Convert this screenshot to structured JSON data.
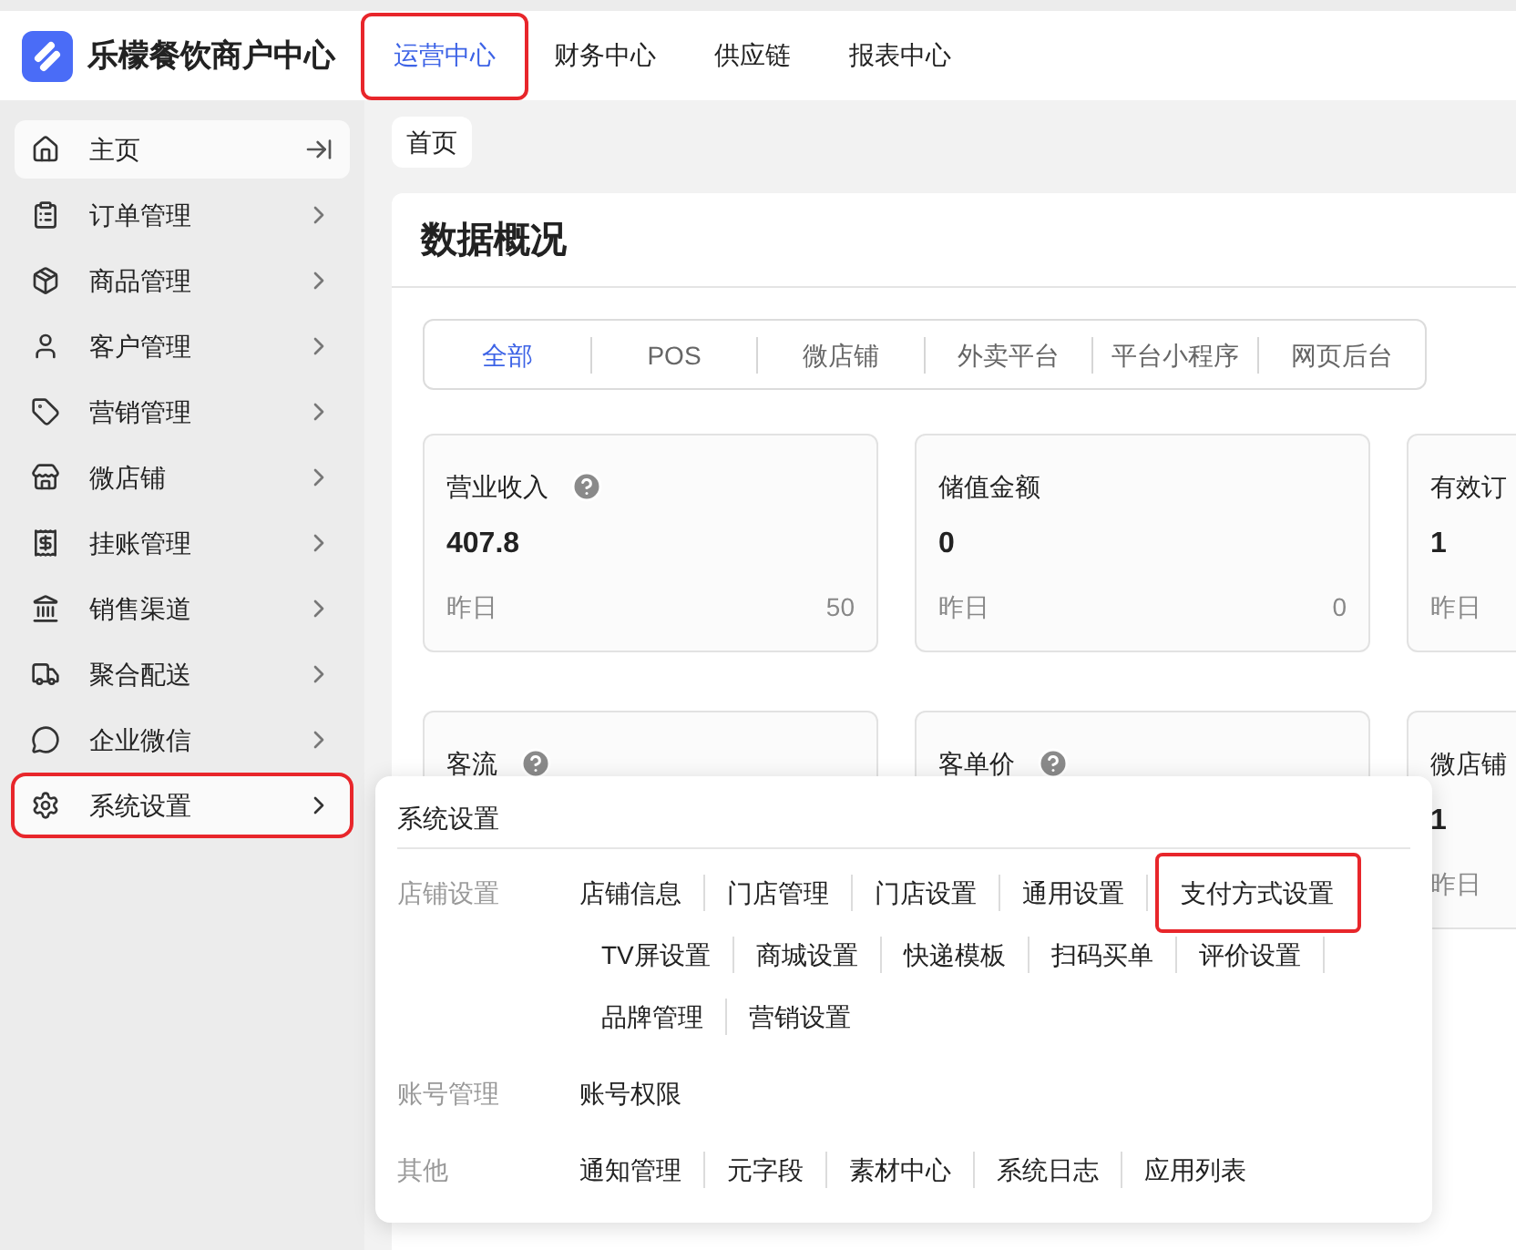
{
  "brand": {
    "title": "乐檬餐饮商户中心"
  },
  "top_nav": [
    {
      "label": "运营中心",
      "selected": true,
      "highlighted": true
    },
    {
      "label": "财务中心",
      "selected": false,
      "highlighted": false
    },
    {
      "label": "供应链",
      "selected": false,
      "highlighted": false
    },
    {
      "label": "报表中心",
      "selected": false,
      "highlighted": false
    }
  ],
  "sidebar": {
    "items": [
      {
        "kind": "home",
        "label": "主页",
        "selected": true,
        "expanded": false,
        "highlighted": false
      },
      {
        "kind": "order",
        "label": "订单管理",
        "selected": false,
        "expanded": false,
        "highlighted": false
      },
      {
        "kind": "goods",
        "label": "商品管理",
        "selected": false,
        "expanded": false,
        "highlighted": false
      },
      {
        "kind": "customer",
        "label": "客户管理",
        "selected": false,
        "expanded": false,
        "highlighted": false
      },
      {
        "kind": "marketing",
        "label": "营销管理",
        "selected": false,
        "expanded": false,
        "highlighted": false
      },
      {
        "kind": "shop",
        "label": "微店铺",
        "selected": false,
        "expanded": false,
        "highlighted": false
      },
      {
        "kind": "credit",
        "label": "挂账管理",
        "selected": false,
        "expanded": false,
        "highlighted": false
      },
      {
        "kind": "channel",
        "label": "销售渠道",
        "selected": false,
        "expanded": false,
        "highlighted": false
      },
      {
        "kind": "delivery",
        "label": "聚合配送",
        "selected": false,
        "expanded": false,
        "highlighted": false
      },
      {
        "kind": "wechat",
        "label": "企业微信",
        "selected": false,
        "expanded": false,
        "highlighted": false
      },
      {
        "kind": "settings",
        "label": "系统设置",
        "selected": true,
        "expanded": true,
        "highlighted": true
      }
    ]
  },
  "page_tabs": [
    {
      "label": "首页",
      "selected": true
    }
  ],
  "overview": {
    "title": "数据概况",
    "filters": [
      {
        "label": "全部",
        "selected": true
      },
      {
        "label": "POS",
        "selected": false
      },
      {
        "label": "微店铺",
        "selected": false
      },
      {
        "label": "外卖平台",
        "selected": false
      },
      {
        "label": "平台小程序",
        "selected": false
      },
      {
        "label": "网页后台",
        "selected": false
      }
    ],
    "cards": [
      {
        "label": "营业收入",
        "help": true,
        "value": "407.8",
        "compare_label": "昨日",
        "compare_value": "50"
      },
      {
        "label": "储值金额",
        "value": "0",
        "compare_label": "昨日",
        "compare_value": "0"
      },
      {
        "label": "有效订",
        "value": "1",
        "compare_label": "昨日"
      },
      {
        "label": "客流",
        "help": true
      },
      {
        "label": "客单价",
        "help": true
      },
      {
        "label": "微店铺",
        "value": "1",
        "compare_label": "昨日"
      }
    ]
  },
  "settings_menu": {
    "title": "系统设置",
    "groups": [
      {
        "label": "店铺设置",
        "items": [
          {
            "label": "店铺信息",
            "highlighted": false
          },
          {
            "label": "门店管理",
            "highlighted": false
          },
          {
            "label": "门店设置",
            "highlighted": false
          },
          {
            "label": "通用设置",
            "highlighted": false
          },
          {
            "label": "支付方式设置",
            "highlighted": true
          },
          {
            "label": "TV屏设置",
            "highlighted": false
          },
          {
            "label": "商城设置",
            "highlighted": false
          },
          {
            "label": "快递模板",
            "highlighted": false
          },
          {
            "label": "扫码买单",
            "highlighted": false
          },
          {
            "label": "评价设置",
            "highlighted": false
          },
          {
            "label": "品牌管理",
            "highlighted": false
          },
          {
            "label": "营销设置",
            "highlighted": false
          }
        ]
      },
      {
        "label": "账号管理",
        "items": [
          {
            "label": "账号权限",
            "highlighted": false
          }
        ]
      },
      {
        "label": "其他",
        "items": [
          {
            "label": "通知管理",
            "highlighted": false
          },
          {
            "label": "元字段",
            "highlighted": false
          },
          {
            "label": "素材中心",
            "highlighted": false
          },
          {
            "label": "系统日志",
            "highlighted": false
          },
          {
            "label": "应用列表",
            "highlighted": false
          }
        ]
      }
    ]
  }
}
